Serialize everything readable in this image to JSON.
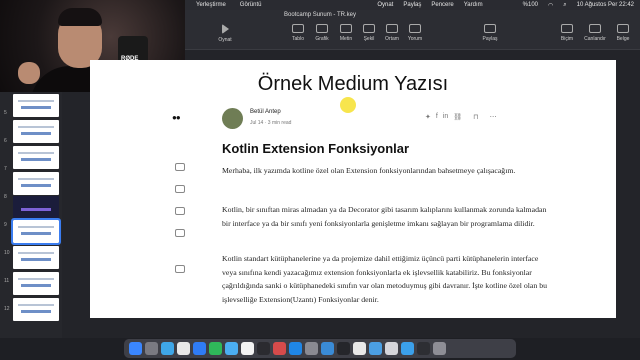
{
  "menubar": {
    "items": [
      "Yerleştirme",
      "Görüntü"
    ],
    "right_items": [
      "Oynat",
      "Paylaş",
      "Pencere",
      "Yardım"
    ],
    "battery": "%100",
    "datetime": "10 Ağustos Per 22:42"
  },
  "window": {
    "title": "Bootcamp Sunum - TR.key"
  },
  "toolbar": {
    "play": "Oynat",
    "table": "Tablo",
    "chart": "Grafik",
    "text": "Metin",
    "shape": "Şekil",
    "media": "Ortam",
    "comment": "Yorum",
    "share": "Paylaş",
    "format": "Biçim",
    "animate": "Canlandır",
    "document": "Belge"
  },
  "webcam": {
    "mic_label": "RØDE"
  },
  "sidebar": {
    "slide_numbers": [
      "5",
      "6",
      "7",
      "8",
      "9",
      "10",
      "11",
      "12"
    ]
  },
  "slide": {
    "title": "Örnek Medium Yazısı",
    "author": "Betül Antep",
    "date": "Jul 14",
    "read_time": "3 min read",
    "dot": "·",
    "logo": "●●",
    "heading": "Kotlin Extension Fonksiyonlar",
    "p1": "Merhaba, ilk yazımda kotline özel olan Extension fonksiyonlarından bahsetmeye çalışacağım.",
    "p2": "Kotlin, bir sınıftan miras almadan ya da Decorator gibi tasarım kalıplarını kullanmak zorunda kalmadan bir interface ya da bir sınıfı yeni fonksiyonlarla genişletme imkanı sağlayan bir programlama dilidir.",
    "p3": "Kotlin standart kütüphanelerine ya da projemize dahil ettiğimiz üçüncü parti kütüphanelerin interface veya sınıfına kendi yazacağımız extension fonksiyonlarla ek işlevsellik katabiliriz. Bu fonksiyonlar çağrıldığında sanki o kütüphanedeki sınıfın var olan metoduymuş gibi davranır. İşte kotline özel olan bu işlevselliğe Extension(Uzantı) Fonksiyonlar denir."
  }
}
